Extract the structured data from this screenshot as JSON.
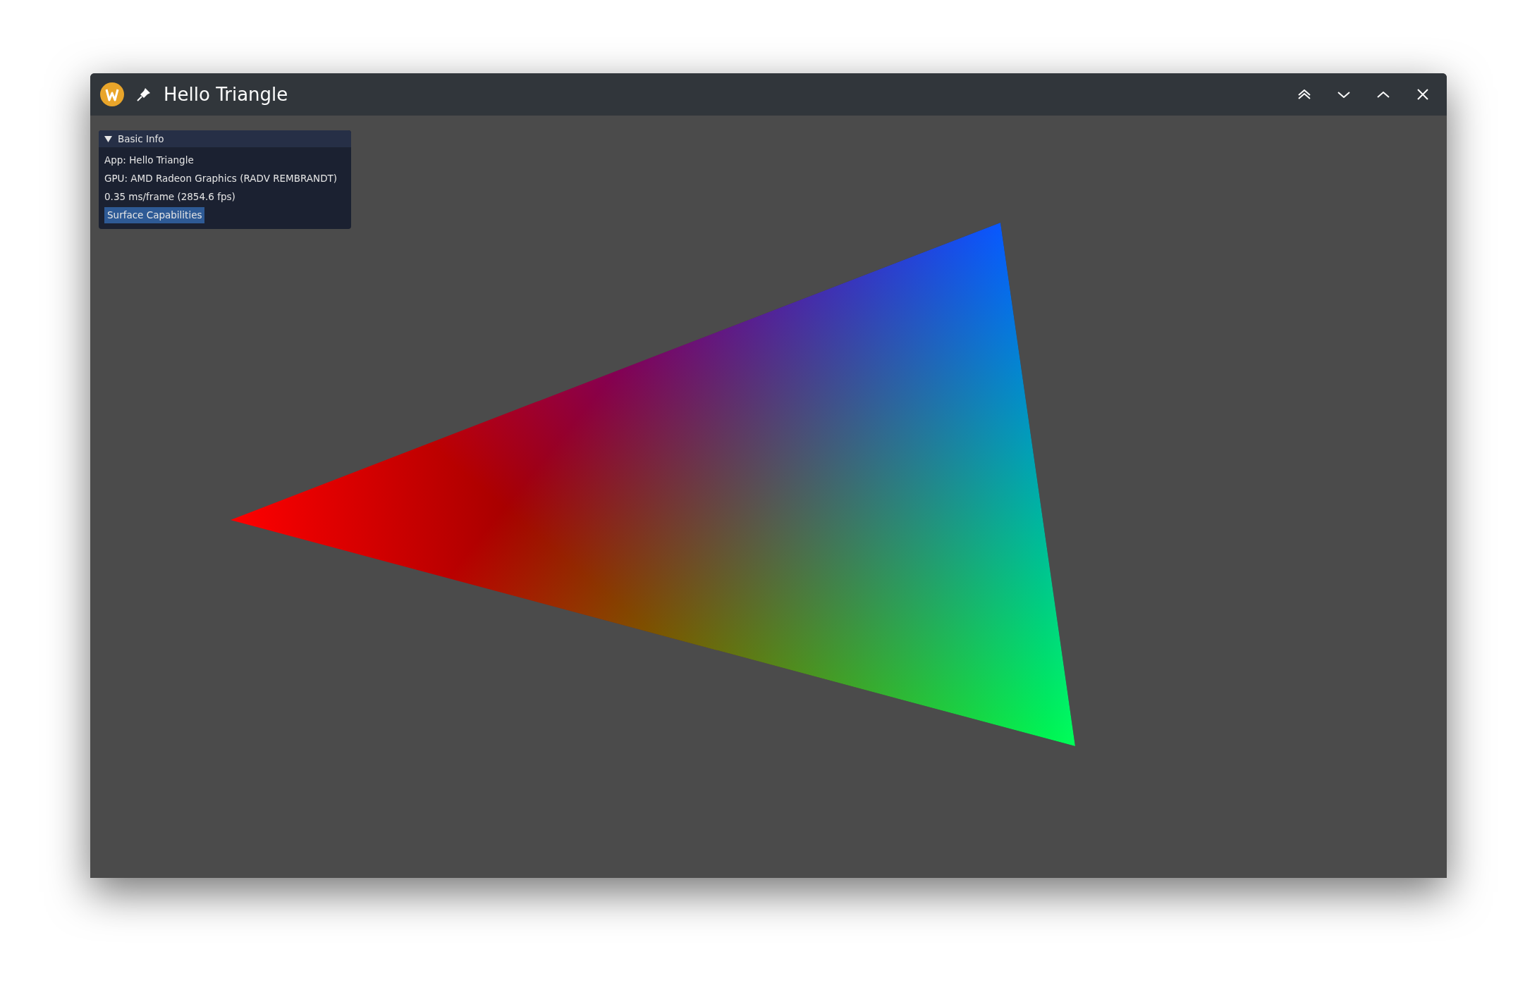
{
  "window": {
    "title": "Hello Triangle"
  },
  "panel": {
    "header": "Basic Info",
    "expanded": true,
    "lines": [
      "App: Hello Triangle",
      "GPU: AMD Radeon Graphics (RADV REMBRANDT)",
      "0.35 ms/frame (2854.6 fps)"
    ],
    "button": "Surface Capabilities"
  }
}
